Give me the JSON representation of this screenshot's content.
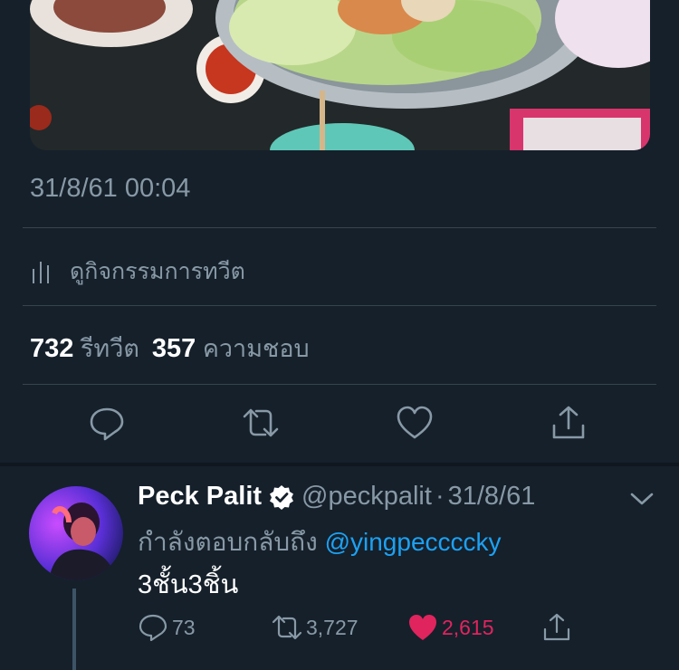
{
  "tweet": {
    "timestamp": "31/8/61 00:04",
    "activity_label": "ดูกิจกรรมการทวีต",
    "retweet_count": "732",
    "retweet_label": "รีทวีต",
    "like_count": "357",
    "like_label": "ความชอบ",
    "actions": [
      {
        "name": "reply",
        "icon": "reply-icon"
      },
      {
        "name": "retweet",
        "icon": "retweet-icon"
      },
      {
        "name": "like",
        "icon": "heart-icon"
      },
      {
        "name": "share",
        "icon": "share-icon"
      }
    ]
  },
  "reply": {
    "display_name": "Peck Palit",
    "verified": true,
    "handle": "@peckpalit",
    "separator": "·",
    "date": "31/8/61",
    "replying_to_label": "กำลังตอบกลับถึง",
    "replying_to_handle": "@yingpeccccky",
    "text": "3ชั้น3ชิ้น",
    "reply_count": "73",
    "retweet_count": "3,727",
    "like_count": "2,615",
    "liked": true
  },
  "colors": {
    "background": "#15202b",
    "secondary_text": "#8899a6",
    "mention": "#1da1f2",
    "like": "#e0245e",
    "divider": "#38444d"
  }
}
